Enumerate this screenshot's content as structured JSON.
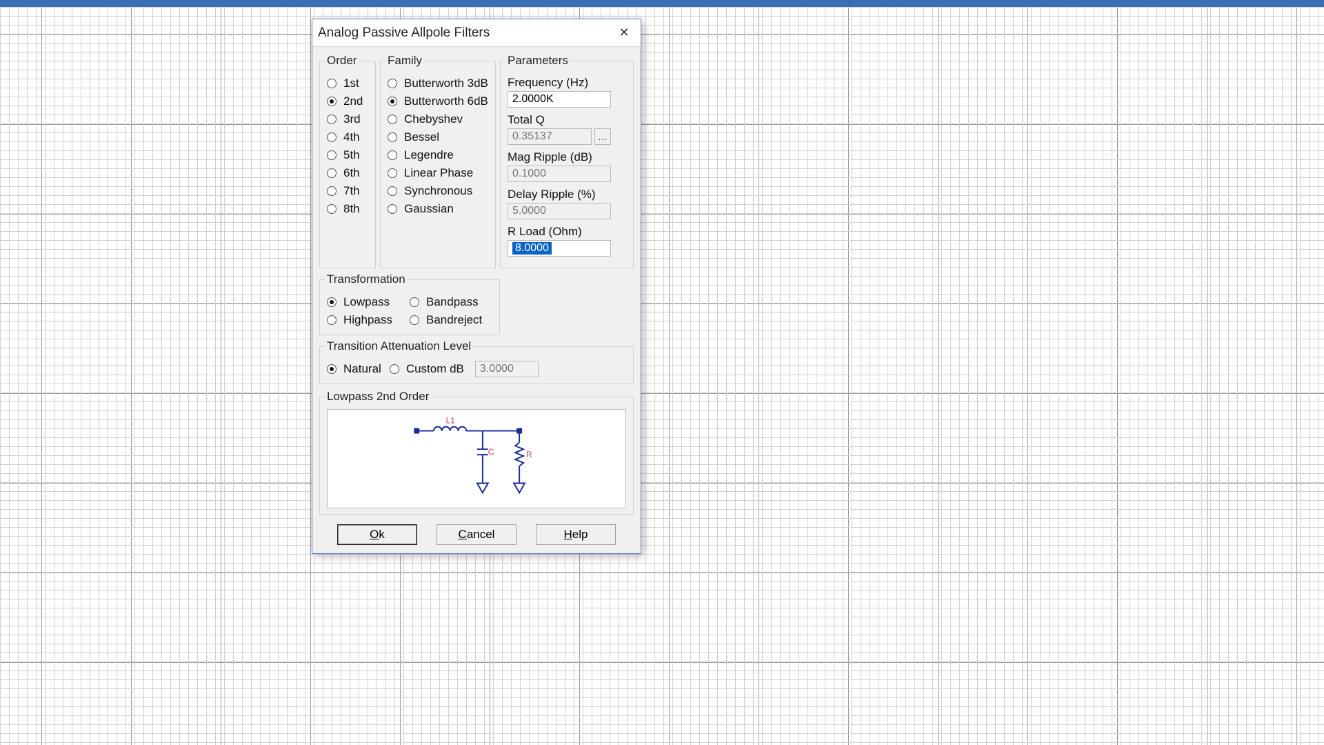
{
  "window": {
    "title": "Analog Passive Allpole Filters"
  },
  "order": {
    "legend": "Order",
    "options": [
      "1st",
      "2nd",
      "3rd",
      "4th",
      "5th",
      "6th",
      "7th",
      "8th"
    ],
    "selected": "2nd"
  },
  "family": {
    "legend": "Family",
    "options": [
      "Butterworth 3dB",
      "Butterworth 6dB",
      "Chebyshev",
      "Bessel",
      "Legendre",
      "Linear Phase",
      "Synchronous",
      "Gaussian"
    ],
    "selected": "Butterworth 6dB"
  },
  "parameters": {
    "legend": "Parameters",
    "frequency_label": "Frequency (Hz)",
    "frequency_value": "2.0000K",
    "totalq_label": "Total Q",
    "totalq_value": "0.35137",
    "magripple_label": "Mag Ripple (dB)",
    "magripple_value": "0.1000",
    "delayripple_label": "Delay Ripple (%)",
    "delayripple_value": "5.0000",
    "rload_label": "R Load (Ohm)",
    "rload_value": "8.0000"
  },
  "transformation": {
    "legend": "Transformation",
    "options": [
      "Lowpass",
      "Highpass",
      "Bandpass",
      "Bandreject"
    ],
    "selected": "Lowpass"
  },
  "tal": {
    "legend": "Transition Attenuation Level",
    "options": [
      "Natural",
      "Custom dB"
    ],
    "selected": "Natural",
    "custom_value": "3.0000"
  },
  "preview": {
    "legend": "Lowpass 2nd Order",
    "inductor_label": "L1"
  },
  "buttons": {
    "ok": "Ok",
    "cancel": "Cancel",
    "help": "Help"
  }
}
